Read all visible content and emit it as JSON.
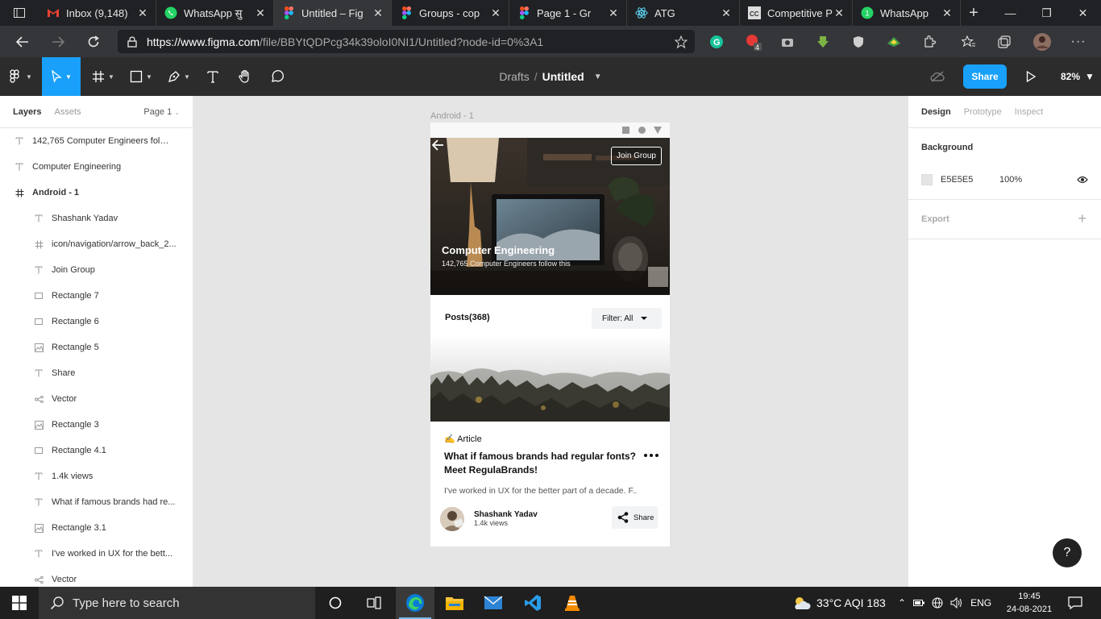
{
  "browser": {
    "tabs": [
      {
        "label": "Inbox (9,148)",
        "icon": "gmail-icon",
        "active": false
      },
      {
        "label": "WhatsApp सु",
        "icon": "whatsapp-icon",
        "active": false
      },
      {
        "label": "Untitled – Fig",
        "icon": "figma-icon",
        "active": true
      },
      {
        "label": "Groups - cop",
        "icon": "figma-icon",
        "active": false
      },
      {
        "label": "Page 1 - Gr",
        "icon": "figma-icon",
        "active": false
      },
      {
        "label": "ATG",
        "icon": "react-icon",
        "active": false
      },
      {
        "label": "Competitive P",
        "icon": "cc-icon",
        "active": false
      },
      {
        "label": "WhatsApp",
        "icon": "whatsapp-icon",
        "active": false
      }
    ],
    "url_host": "https://www.figma.com",
    "url_rest": "/file/BBYtQDPcg34k39oloI0NI1/Untitled?node-id=0%3A1",
    "extension_badge": "4"
  },
  "figma": {
    "breadcrumb_parent": "Drafts",
    "breadcrumb_sep": "/",
    "file_title": "Untitled",
    "share_label": "Share",
    "zoom": "82%",
    "left_tabs": {
      "layers": "Layers",
      "assets": "Assets",
      "page": "Page 1"
    },
    "layers": [
      {
        "name": "142,765 Computer Engineers follo...",
        "type": "text",
        "level": 0
      },
      {
        "name": "Computer Engineering",
        "type": "text",
        "level": 0
      },
      {
        "name": "Android - 1",
        "type": "frame",
        "level": 0
      },
      {
        "name": "Shashank Yadav",
        "type": "text",
        "level": 1
      },
      {
        "name": "icon/navigation/arrow_back_2...",
        "type": "frame",
        "level": 1
      },
      {
        "name": "Join Group",
        "type": "text",
        "level": 1
      },
      {
        "name": "Rectangle 7",
        "type": "rect",
        "level": 1
      },
      {
        "name": "Rectangle 6",
        "type": "rect",
        "level": 1
      },
      {
        "name": "Rectangle 5",
        "type": "image",
        "level": 1
      },
      {
        "name": "Share",
        "type": "text",
        "level": 1
      },
      {
        "name": "Vector",
        "type": "vector",
        "level": 1
      },
      {
        "name": "Rectangle 3",
        "type": "image",
        "level": 1
      },
      {
        "name": "Rectangle 4.1",
        "type": "rect",
        "level": 1
      },
      {
        "name": "1.4k views",
        "type": "text",
        "level": 1
      },
      {
        "name": "What if famous brands had re...",
        "type": "text",
        "level": 1
      },
      {
        "name": "Rectangle 3.1",
        "type": "image",
        "level": 1
      },
      {
        "name": "I've worked in UX for the bett...",
        "type": "text",
        "level": 1
      },
      {
        "name": "Vector",
        "type": "vector",
        "level": 1
      }
    ],
    "right_tabs": {
      "design": "Design",
      "prototype": "Prototype",
      "inspect": "Inspect"
    },
    "background_label": "Background",
    "background_hex": "E5E5E5",
    "background_opacity": "100%",
    "export_label": "Export",
    "help_label": "?"
  },
  "canvas": {
    "frame_label": "Android - 1",
    "join_label": "Join Group",
    "hero_title": "Computer Engineering",
    "hero_sub": "142,765 Computer Engineers follow this",
    "posts_label": "Posts(368)",
    "filter_label": "Filter: All",
    "article_tag": "✍️ Article",
    "post_title": "What if famous brands had regular fonts? Meet RegulaBrands!",
    "post_excerpt": "I've worked in UX for the better part of a decade. F..",
    "author_name": "Shashank Yadav",
    "author_views": "1.4k views",
    "share_label": "Share"
  },
  "taskbar": {
    "search_placeholder": "Type here to search",
    "weather": "33°C  AQI 183",
    "lang": "ENG",
    "time": "19:45",
    "date": "24-08-2021"
  },
  "colors": {
    "figma_blue": "#18A0FB",
    "toolbar": "#2C2C2C",
    "canvas_bg": "#E5E5E5"
  }
}
